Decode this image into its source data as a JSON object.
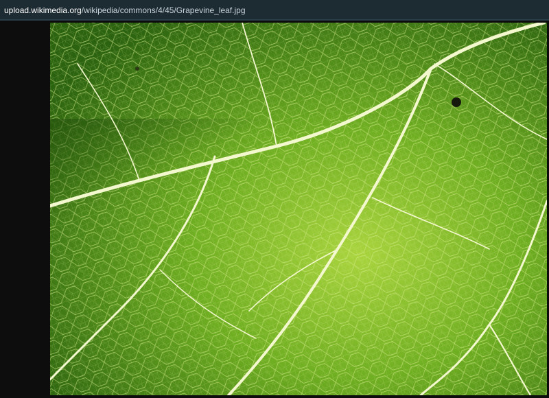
{
  "window": {
    "url": {
      "host": "upload.wikimedia.org",
      "path": "/wikipedia/commons/4/45/Grapevine_leaf.jpg"
    }
  },
  "colors": {
    "chrome_bar": "#1d2b33",
    "backdrop": "#0d0d0e",
    "leaf_dark": "#2f6510",
    "leaf_mid": "#5e9c1c",
    "leaf_light": "#9fcd3a",
    "vein": "#f3f7c8"
  },
  "image": {
    "subject": "grapevine-leaf-photo"
  }
}
